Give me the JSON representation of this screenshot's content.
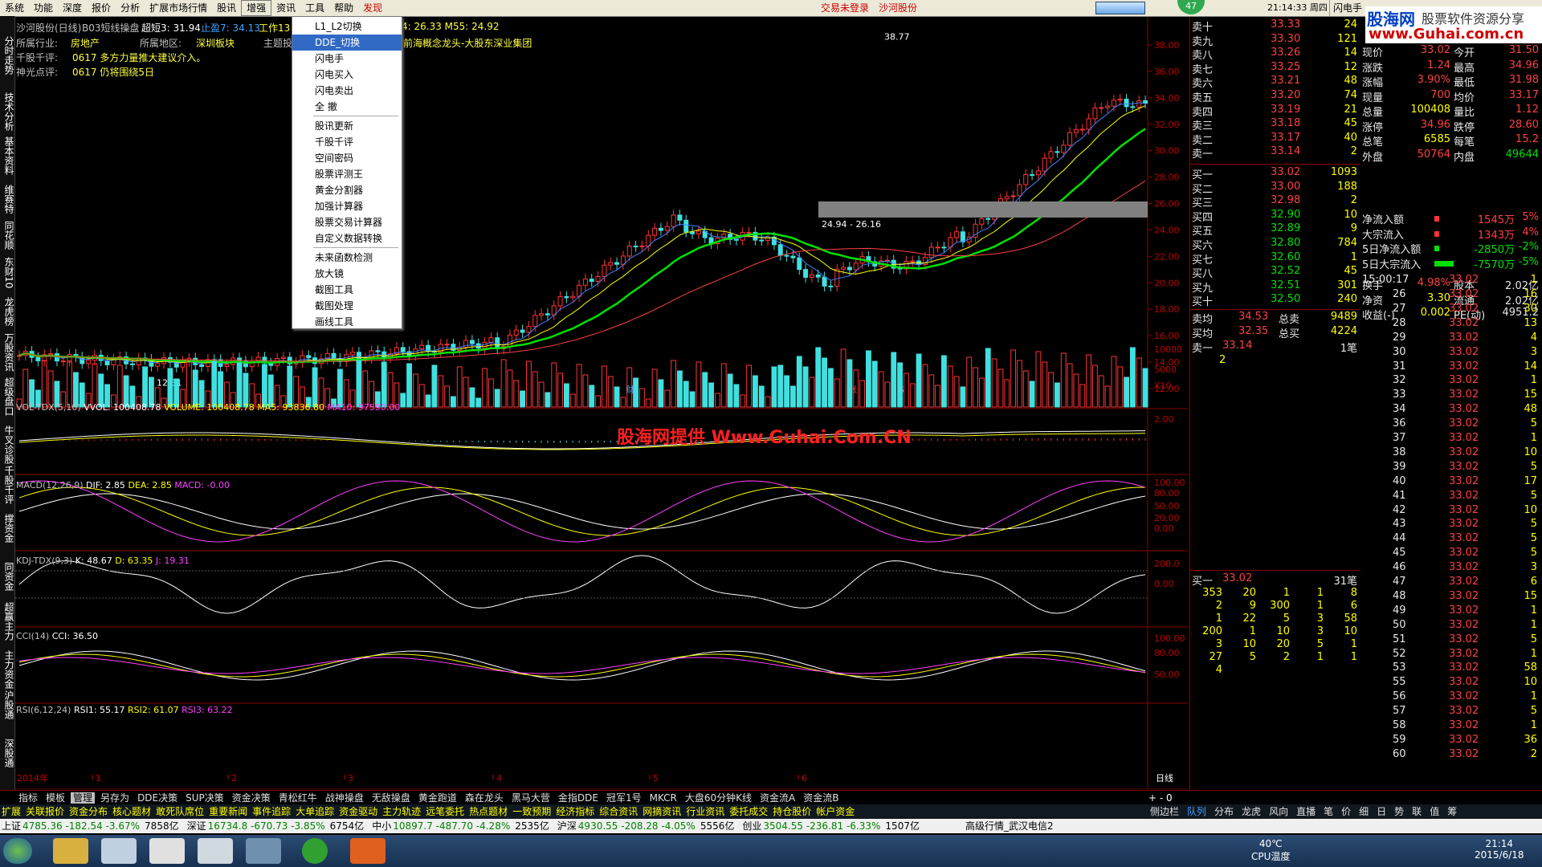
{
  "menu": [
    "系统",
    "功能",
    "深度",
    "报价",
    "分析",
    "扩展市场行情",
    "股讯",
    "增强",
    "资讯",
    "工具",
    "帮助",
    "发现"
  ],
  "menu_status": [
    "交易未登录",
    "沙河股份"
  ],
  "menu_right": {
    "time": "21:14:33 周四",
    "button": "闪电手",
    "badge": "47"
  },
  "logo": {
    "title": "股海网",
    "subtitle": "股票软件资源分享",
    "url": "www.Guhai.com.cn"
  },
  "left_tabs": [
    "分时走势",
    "技术分析",
    "基本资料",
    "维赛特",
    "同花顺",
    "东财10",
    "龙虎榜",
    "万股资讯",
    "超级盘口",
    "牛叉诊股",
    "千股千评",
    "撑资金",
    "同资金",
    "超赢主力",
    "主力资金",
    "沪股通",
    "深股通"
  ],
  "header": {
    "stock": "沙河股份(日线)",
    "indicator": "B03短线操盘",
    "super3": "超短3: 31.94",
    "zhiying": "止盈7: 34.13",
    "work": "工作13",
    "ma": "4: 26.33 M55: 24.92",
    "industry_label": "所属行业:",
    "industry": "房地产",
    "region_label": "所属地区:",
    "region": "深圳板块",
    "topic_label": "主题投",
    "concept": "前海概念龙头-大股东深业集团",
    "qp_label": "千股千评:",
    "qp": "0617 多方力量推大建议介入。",
    "sg_label": "神光点评:",
    "sg": "0617 仍将围绕5日"
  },
  "dropdown": {
    "items": [
      "L1_L2切换",
      "DDE_切换",
      "闪电手",
      "闪电买入",
      "闪电卖出",
      "全  撤",
      "股讯更新",
      "千股千评",
      "空间密码",
      "股票评测王",
      "黄金分割器",
      "加强计算器",
      "股票交易计算器",
      "自定义数据转换",
      "未来函数检测",
      "放大镜",
      "截图工具",
      "截图处理",
      "画线工具"
    ],
    "selected": "DDE_切换"
  },
  "price_axis": [
    "38.00",
    "36.00",
    "34.00",
    "32.00",
    "30.00",
    "28.00",
    "26.00",
    "24.00",
    "22.00",
    "20.00",
    "18.00",
    "16.00",
    "14.00",
    "12.00"
  ],
  "chart_labels": {
    "high": "38.77",
    "low": "12.31",
    "band": "24.94 - 26.16",
    "cai": "财",
    "zhang": "涨",
    "s": "S",
    "year": "2014年",
    "months": [
      "1",
      "2",
      "3",
      "4",
      "5",
      "6"
    ],
    "period": "日线"
  },
  "vol_panel": {
    "title": "VOL-TDX(5,10)",
    "vvol": "VVOL: 100408.78",
    "volume": "VOLUME: 100408.78",
    "ma5": "MA5: 93836.80",
    "ma10": "MA10: 97590.00",
    "ticks": [
      "10000",
      "5000"
    ],
    "unit": "X10"
  },
  "watermark": "股海网提供 Www.Guhai.Com.CN",
  "macd_panel": {
    "title": "MACD(12,26,9)",
    "dif": "DIF: 2.85",
    "dea": "DEA: 2.85",
    "macd": "MACD: -0.00",
    "tick": "2.00"
  },
  "kdj_panel": {
    "title": "KDJ-TDX(9,3)",
    "k": "K: 48.67",
    "d": "D: 63.35",
    "j": "J: 19.31",
    "ticks": [
      "100.00",
      "80.00",
      "50.00",
      "20.00",
      "0.00"
    ]
  },
  "cci_panel": {
    "title": "CCI(14)",
    "cci": "CCI: 36.50",
    "ticks": [
      "200.0",
      "0.00"
    ]
  },
  "rsi_panel": {
    "title": "RSI(6,12,24)",
    "rsi1": "RSI1: 55.17",
    "rsi2": "RSI2: 61.07",
    "rsi3": "RSI3: 63.22",
    "ticks": [
      "100.00",
      "80.00",
      "50.00"
    ]
  },
  "sell_book": [
    {
      "label": "卖十",
      "price": "33.33",
      "vol": "24"
    },
    {
      "label": "卖九",
      "price": "33.30",
      "vol": "121"
    },
    {
      "label": "卖八",
      "price": "33.26",
      "vol": "14"
    },
    {
      "label": "卖七",
      "price": "33.25",
      "vol": "12"
    },
    {
      "label": "卖六",
      "price": "33.21",
      "vol": "48"
    },
    {
      "label": "卖五",
      "price": "33.20",
      "vol": "74"
    },
    {
      "label": "卖四",
      "price": "33.19",
      "vol": "21"
    },
    {
      "label": "卖三",
      "price": "33.18",
      "vol": "45"
    },
    {
      "label": "卖二",
      "price": "33.17",
      "vol": "40"
    },
    {
      "label": "卖一",
      "price": "33.14",
      "vol": "2"
    }
  ],
  "buy_book": [
    {
      "label": "买一",
      "price": "33.02",
      "vol": "1093"
    },
    {
      "label": "买二",
      "price": "33.00",
      "vol": "188"
    },
    {
      "label": "买三",
      "price": "32.98",
      "vol": "2"
    },
    {
      "label": "买四",
      "price": "32.90",
      "vol": "10"
    },
    {
      "label": "买五",
      "price": "32.89",
      "vol": "9"
    },
    {
      "label": "买六",
      "price": "32.80",
      "vol": "784"
    },
    {
      "label": "买七",
      "price": "32.60",
      "vol": "1"
    },
    {
      "label": "买八",
      "price": "32.52",
      "vol": "45"
    },
    {
      "label": "买九",
      "price": "32.51",
      "vol": "301"
    },
    {
      "label": "买十",
      "price": "32.50",
      "vol": "240"
    }
  ],
  "book_summary": [
    {
      "l1": "卖均",
      "v1": "34.53",
      "l2": "总卖",
      "v2": "9489"
    },
    {
      "l1": "买均",
      "v1": "32.35",
      "l2": "总买",
      "v2": "4224"
    }
  ],
  "sell1_line": {
    "label": "卖一",
    "price": "33.14",
    "vol": "1笔",
    "sub": "2"
  },
  "buy1_line": {
    "label": "买一",
    "price": "33.02",
    "vol": "31笔"
  },
  "buy_queue": [
    [
      "353",
      "20",
      "1",
      "1",
      "8"
    ],
    [
      "2",
      "9",
      "300",
      "1",
      "6"
    ],
    [
      "1",
      "22",
      "5",
      "3",
      "58"
    ],
    [
      "200",
      "1",
      "10",
      "3",
      "10"
    ],
    [
      "3",
      "10",
      "20",
      "5",
      "1"
    ],
    [
      "27",
      "5",
      "2",
      "1",
      "1"
    ],
    [
      "4",
      "",
      "",
      "",
      ""
    ]
  ],
  "stats": [
    {
      "l1": "现价",
      "v1": "33.02",
      "l2": "今开",
      "v2": "31.50"
    },
    {
      "l1": "涨跌",
      "v1": "1.24",
      "l2": "最高",
      "v2": "34.96"
    },
    {
      "l1": "涨幅",
      "v1": "3.90%",
      "l2": "最低",
      "v2": "31.98"
    },
    {
      "l1": "现量",
      "v1": "700",
      "l2": "均价",
      "v2": "33.17"
    },
    {
      "l1": "总量",
      "v1": "100408",
      "l2": "量比",
      "v2": "1.12"
    },
    {
      "l1": "涨停",
      "v1": "34.96",
      "l2": "跌停",
      "v2": "28.60"
    },
    {
      "l1": "总笔",
      "v1": "6585",
      "l2": "每笔",
      "v2": "15.2"
    },
    {
      "l1": "外盘",
      "v1": "50764",
      "l2": "内盘",
      "v2": "49644"
    },
    {
      "l1": "换手",
      "v1": "4.98%",
      "l2": "股本",
      "v2": "2.02亿"
    },
    {
      "l1": "净资",
      "v1": "3.30",
      "l2": "流通",
      "v2": "2.02亿"
    },
    {
      "l1": "收益(-)",
      "v1": "0.002",
      "l2": "PE(动)",
      "v2": "4951.2"
    }
  ],
  "flows": [
    {
      "label": "净流入额",
      "value": "1545万",
      "pct": "5%"
    },
    {
      "label": "大宗流入",
      "value": "1343万",
      "pct": "4%"
    },
    {
      "label": "5日净流入额",
      "value": "-2850万",
      "pct": "-2%"
    },
    {
      "label": "5日大宗流入",
      "value": "-7570万",
      "pct": "-5%"
    }
  ],
  "ticks_header": {
    "time": "15:00:17",
    "price": "33.02",
    "vol": "1"
  },
  "tick_rows": [
    [
      "26",
      "33.02",
      "16"
    ],
    [
      "27",
      "33.02",
      "30"
    ],
    [
      "28",
      "33.02",
      "13"
    ],
    [
      "29",
      "33.02",
      "4"
    ],
    [
      "30",
      "33.02",
      "3"
    ],
    [
      "31",
      "33.02",
      "14"
    ],
    [
      "32",
      "33.02",
      "1"
    ],
    [
      "33",
      "33.02",
      "15"
    ],
    [
      "34",
      "33.02",
      "48"
    ],
    [
      "36",
      "33.02",
      "5"
    ],
    [
      "37",
      "33.02",
      "1"
    ],
    [
      "38",
      "33.02",
      "10"
    ],
    [
      "39",
      "33.02",
      "5"
    ],
    [
      "40",
      "33.02",
      "17"
    ],
    [
      "41",
      "33.02",
      "5"
    ],
    [
      "42",
      "33.02",
      "10"
    ],
    [
      "43",
      "33.02",
      "5"
    ],
    [
      "44",
      "33.02",
      "5"
    ],
    [
      "45",
      "33.02",
      "5"
    ],
    [
      "46",
      "33.02",
      "3"
    ],
    [
      "47",
      "33.02",
      "6"
    ],
    [
      "48",
      "33.02",
      "15"
    ],
    [
      "49",
      "33.02",
      "1"
    ],
    [
      "50",
      "33.02",
      "1"
    ],
    [
      "51",
      "33.02",
      "5"
    ],
    [
      "52",
      "33.02",
      "1"
    ],
    [
      "53",
      "33.02",
      "58"
    ],
    [
      "55",
      "33.02",
      "10"
    ],
    [
      "56",
      "33.02",
      "1"
    ],
    [
      "57",
      "33.02",
      "5"
    ],
    [
      "58",
      "33.02",
      "1"
    ],
    [
      "59",
      "33.02",
      "36"
    ],
    [
      "60",
      "33.02",
      "2"
    ]
  ],
  "indicator_tabs": [
    "指标",
    "模板",
    "管理",
    "另存为",
    "DDE决策",
    "SUP决策",
    "资金决策",
    "青松红牛",
    "战神操盘",
    "无敌操盘",
    "黄金跑道",
    "森在龙头",
    "黑马大营",
    "金指DDE",
    "冠军1号",
    "MKCR",
    "大盘60分钟K线",
    "资金流A",
    "资金流B"
  ],
  "info_tabs": [
    "扩展",
    "关联报价",
    "资金分布",
    "核心题材",
    "敢死队席位",
    "重要新闻",
    "事件追踪",
    "大单追踪",
    "资金驱动",
    "主力轨迹",
    "远笔委托",
    "热点题材",
    "一致预期",
    "经济指标",
    "综合资讯",
    "网摘资讯",
    "行业资讯",
    "委托成交",
    "持仓股价",
    "帐户资金"
  ],
  "right_tabs": [
    "侧边栏",
    "队列",
    "分布",
    "龙虎",
    "风向",
    "直播",
    "笔",
    "价",
    "细",
    "日",
    "势",
    "联",
    "值",
    "筹"
  ],
  "index_bar": [
    {
      "name": "上证",
      "text": "4785.36 -182.54 -3.67%",
      "amount": "7858亿"
    },
    {
      "name": "深证",
      "text": "16734.8 -670.73 -3.85%",
      "amount": "6754亿"
    },
    {
      "name": "中小",
      "text": "10897.7 -487.70 -4.28%",
      "amount": "2535亿"
    },
    {
      "name": "沪深",
      "text": "4930.55 -208.28 -4.05%",
      "amount": "5556亿"
    },
    {
      "name": "创业",
      "text": "3504.55 -236.81 -6.33%",
      "amount": "1507亿"
    }
  ],
  "status_text": "高级行情_武汉电信2",
  "taskbar": {
    "temp": "40℃",
    "temp_label": "CPU温度",
    "time": "21:14",
    "date": "2015/6/18"
  },
  "colors": {
    "up": "#ff3333",
    "down": "#40e0e0",
    "grid": "#8b0000",
    "ma5": "#ffffff",
    "ma10": "#ffff00",
    "ma20": "#ff00ff",
    "ma30": "#00ff00"
  }
}
